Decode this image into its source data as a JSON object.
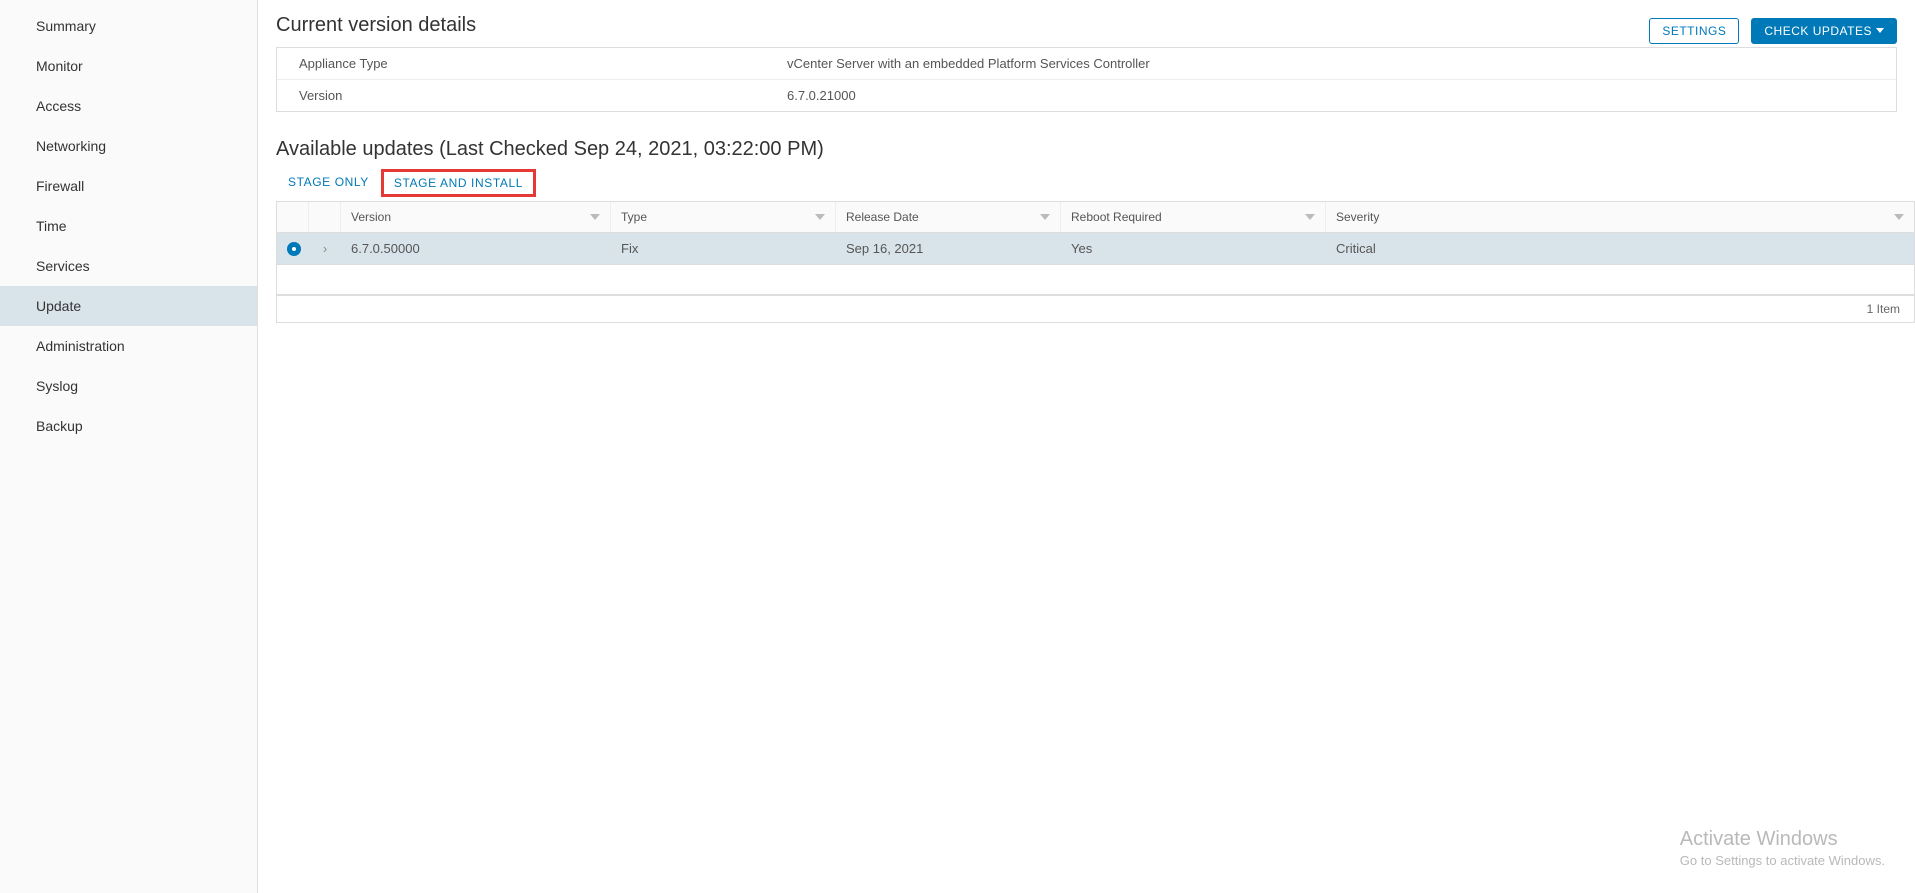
{
  "sidebar": {
    "items": [
      {
        "label": "Summary"
      },
      {
        "label": "Monitor"
      },
      {
        "label": "Access"
      },
      {
        "label": "Networking"
      },
      {
        "label": "Firewall"
      },
      {
        "label": "Time"
      },
      {
        "label": "Services"
      },
      {
        "label": "Update"
      },
      {
        "label": "Administration"
      },
      {
        "label": "Syslog"
      },
      {
        "label": "Backup"
      }
    ],
    "activeIndex": 7
  },
  "header": {
    "title": "Current version details",
    "settings_label": "SETTINGS",
    "check_updates_label": "CHECK UPDATES"
  },
  "current_version": {
    "rows": [
      {
        "label": "Appliance Type",
        "value": "vCenter Server with an embedded Platform Services Controller"
      },
      {
        "label": "Version",
        "value": "6.7.0.21000"
      }
    ]
  },
  "available_updates": {
    "title": "Available updates (Last Checked Sep 24, 2021, 03:22:00 PM)",
    "stage_only_label": "STAGE ONLY",
    "stage_and_install_label": "STAGE AND INSTALL",
    "columns": {
      "version": "Version",
      "type": "Type",
      "release_date": "Release Date",
      "reboot_required": "Reboot Required",
      "severity": "Severity"
    },
    "rows": [
      {
        "version": "6.7.0.50000",
        "type": "Fix",
        "release_date": "Sep 16, 2021",
        "reboot_required": "Yes",
        "severity": "Critical"
      }
    ],
    "footer": "1 Item"
  },
  "watermark": {
    "title": "Activate Windows",
    "subtitle": "Go to Settings to activate Windows."
  }
}
